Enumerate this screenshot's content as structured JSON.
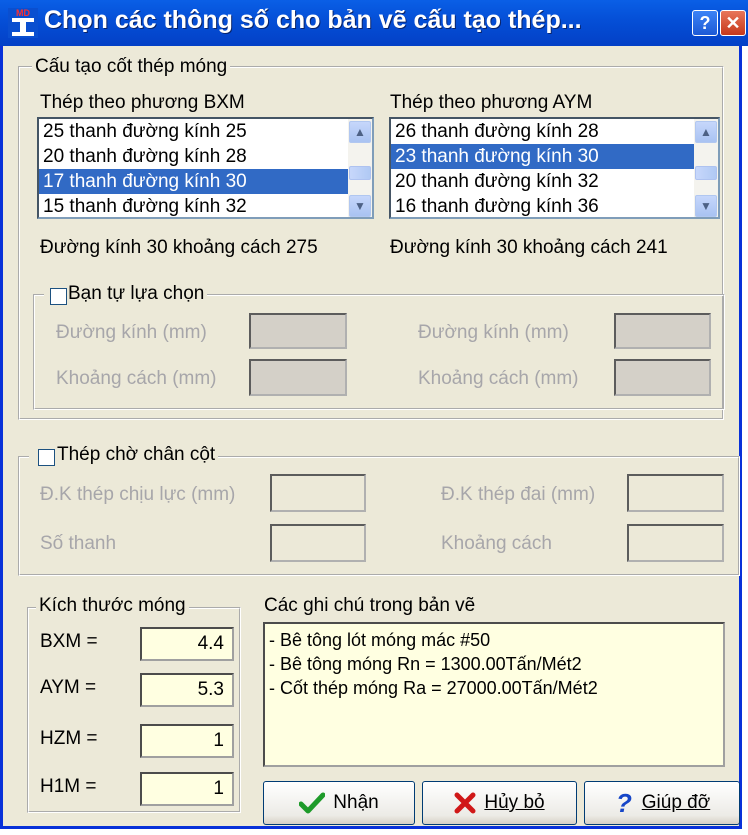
{
  "window": {
    "title": "Chọn các thông số cho bản vẽ cấu tạo thép...",
    "help_btn": "?",
    "close_btn": "✕",
    "app_icon_text": "MD"
  },
  "group_main": {
    "legend": "Cấu tạo cốt thép móng",
    "bxm": {
      "label": "Thép theo phương BXM",
      "items": [
        "25 thanh đường kính 25",
        "20 thanh đường kính 28",
        "17 thanh đường kính 30",
        "15 thanh đường kính 32"
      ],
      "selected_index": 2,
      "info": "Đường kính 30 khoảng cách  275"
    },
    "aym": {
      "label": "Thép theo phương AYM",
      "items": [
        "26 thanh đường kính 28",
        "23 thanh đường kính 30",
        "20 thanh đường kính 32",
        "16 thanh đường kính 36"
      ],
      "selected_index": 1,
      "info": "Đường kính 30 khoảng cách  241"
    },
    "custom": {
      "legend": "Bạn tự lựa chọn",
      "checked": false,
      "duong_kinh_1": "Đường kính (mm)",
      "khoang_cach_1": "Khoảng cách (mm)",
      "duong_kinh_2": "Đường kính (mm)",
      "khoang_cach_2": "Khoảng cách (mm)"
    }
  },
  "group_column": {
    "legend": "Thép chờ chân cột",
    "checked": false,
    "dk_chiu_luc": "Đ.K thép chịu lực (mm)",
    "dk_dai": "Đ.K thép đai (mm)",
    "so_thanh": "Số thanh",
    "khoang_cach": "Khoảng cách"
  },
  "group_size": {
    "legend": "Kích thước móng",
    "fields": [
      {
        "label": "BXM =",
        "value": "4.4"
      },
      {
        "label": "AYM =",
        "value": "5.3"
      },
      {
        "label": "HZM =",
        "value": "1"
      },
      {
        "label": "H1M =",
        "value": "1"
      }
    ]
  },
  "notes": {
    "label": "Các ghi chú trong bản vẽ",
    "lines": [
      "- Bê tông lót móng mác #50",
      "- Bê tông móng Rn = 1300.00Tấn/Mét2",
      "- Cốt thép móng Ra = 27000.00Tấn/Mét2"
    ]
  },
  "buttons": {
    "ok": "Nhận",
    "cancel": "Hủy bỏ",
    "help": "Giúp đỡ"
  },
  "colors": {
    "titlebar": "#0550D8",
    "selection": "#316AC5",
    "input_bg": "#FFFFE1",
    "dialog_bg": "#ECE9D8"
  }
}
